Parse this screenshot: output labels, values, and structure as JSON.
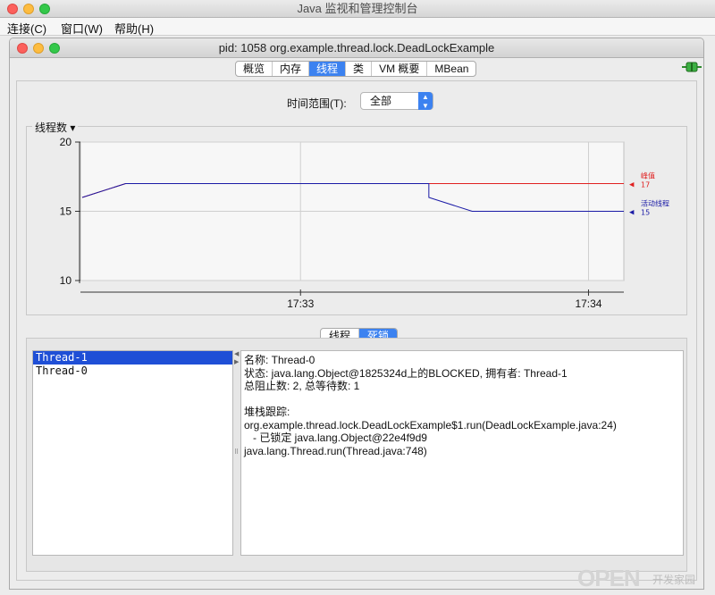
{
  "app": {
    "title": "Java 监视和管理控制台"
  },
  "menu": [
    {
      "label": "连接(C)"
    },
    {
      "label": "窗口(W)"
    },
    {
      "label": "帮助(H)"
    }
  ],
  "window": {
    "title": "pid: 1058 org.example.thread.lock.DeadLockExample"
  },
  "tabs": [
    {
      "label": "概览"
    },
    {
      "label": "内存"
    },
    {
      "label": "线程"
    },
    {
      "label": "类"
    },
    {
      "label": "VM 概要"
    },
    {
      "label": "MBean"
    }
  ],
  "active_tab": "线程",
  "time_range": {
    "label": "时间范围(T):",
    "value": "全部"
  },
  "chart_data": {
    "type": "line",
    "title": "线程数",
    "ylim": [
      10,
      20
    ],
    "yticks": [
      "10",
      "15",
      "20"
    ],
    "xticks": [
      "17:33",
      "17:34"
    ],
    "grid": true,
    "series": [
      {
        "name": "峰值",
        "color": "#e02020",
        "latest": "17",
        "points": [
          [
            0.0,
            16
          ],
          [
            0.08,
            17
          ],
          [
            0.64,
            17
          ],
          [
            1.0,
            17
          ]
        ]
      },
      {
        "name": "活动线程",
        "color": "#1a1aa6",
        "latest": "15",
        "points": [
          [
            0.0,
            16
          ],
          [
            0.08,
            17
          ],
          [
            0.64,
            17
          ],
          [
            0.64,
            16
          ],
          [
            0.72,
            15
          ],
          [
            1.0,
            15
          ]
        ]
      }
    ]
  },
  "sub_tabs": [
    {
      "label": "线程"
    },
    {
      "label": "死锁"
    }
  ],
  "active_sub_tab": "死锁",
  "threads": [
    {
      "name": "Thread-1",
      "selected": true
    },
    {
      "name": "Thread-0",
      "selected": false
    }
  ],
  "detail": {
    "name_line": "名称: Thread-0",
    "state_line": "状态: java.lang.Object@1825324d上的BLOCKED, 拥有者: Thread-1",
    "counts_line": "总阻止数: 2, 总等待数: 1",
    "blank": "",
    "stack_title": "堆栈跟踪:",
    "stack": [
      "org.example.thread.lock.DeadLockExample$1.run(DeadLockExample.java:24)",
      "   - 已锁定 java.lang.Object@22e4f9d9",
      "java.lang.Thread.run(Thread.java:748)"
    ]
  },
  "watermark": {
    "text": "OPEN",
    "sub": "开发家园"
  },
  "colors": {
    "accent": "#3c82f0",
    "selection": "#1f4fd6"
  }
}
